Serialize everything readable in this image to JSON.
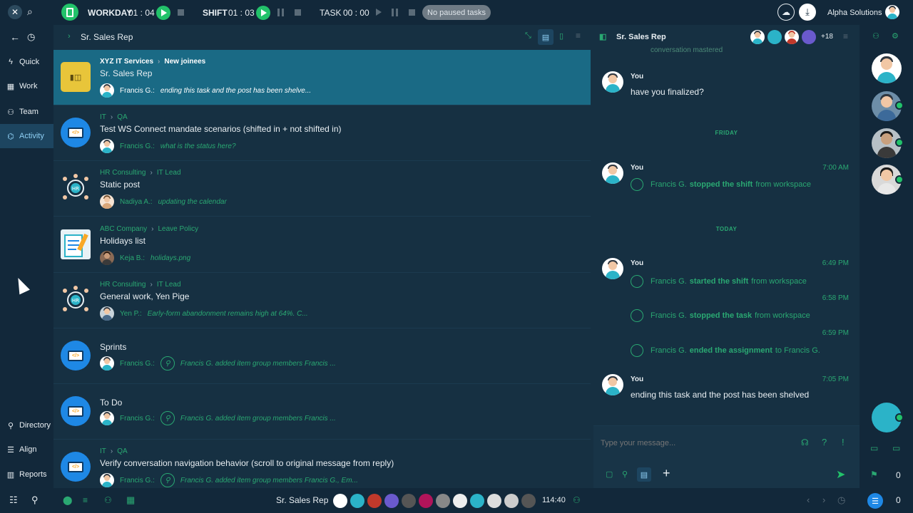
{
  "topbar": {
    "workday_label": "WORKDAY",
    "workday_time": "01 : 04",
    "shift_label": "SHIFT",
    "shift_time": "01 : 03",
    "task_label": "TASK",
    "task_time": "00 : 00",
    "paused_pill": "No paused tasks",
    "org_name": "Alpha Solutions"
  },
  "leftnav": {
    "items": [
      {
        "label": "Quick",
        "icon": "bolt-icon"
      },
      {
        "label": "Work",
        "icon": "grid-icon"
      },
      {
        "label": "Team",
        "icon": "team-icon"
      },
      {
        "label": "Activity",
        "icon": "activity-icon"
      }
    ],
    "bottom_items": [
      {
        "label": "Directory",
        "icon": "directory-icon"
      },
      {
        "label": "Align",
        "icon": "align-icon"
      },
      {
        "label": "Reports",
        "icon": "reports-icon"
      }
    ]
  },
  "list": {
    "header_title": "Sr. Sales Rep",
    "rows": [
      {
        "crumb_a": "XYZ IT Services",
        "crumb_b": "New joinees",
        "title": "Sr. Sales Rep",
        "name": "Francis G.:",
        "msg": "ending this task and the post has been shelve..."
      },
      {
        "crumb_a": "IT",
        "crumb_b": "QA",
        "title": "Test WS Connect mandate scenarios (shifted in + not shifted in)",
        "name": "Francis G.:",
        "msg": "what is the status here?"
      },
      {
        "crumb_a": "HR Consulting",
        "crumb_b": "IT Lead",
        "title": "Static post",
        "name": "Nadiya A.:",
        "msg": "updating the calendar"
      },
      {
        "crumb_a": "ABC Company",
        "crumb_b": "Leave Policy",
        "title": "Holidays list",
        "name": "Keja B.:",
        "msg": "holidays.png"
      },
      {
        "crumb_a": "HR Consulting",
        "crumb_b": "IT Lead",
        "title": "General work, Yen Pige",
        "name": "Yen P.:",
        "msg": "Early-form abandonment remains high at 64%. C..."
      },
      {
        "crumb_a": "",
        "crumb_b": "",
        "title": "Sprints",
        "name": "Francis G.:",
        "msg": "Francis G. added item group members Francis ..."
      },
      {
        "crumb_a": "",
        "crumb_b": "",
        "title": "To Do",
        "name": "Francis G.:",
        "msg": "Francis G. added item group members Francis ..."
      },
      {
        "crumb_a": "IT",
        "crumb_b": "QA",
        "title": "Verify conversation navigation behavior (scroll to original message from reply)",
        "name": "Francis G.:",
        "msg": "Francis G. added item group members Francis G., Em..."
      }
    ]
  },
  "chat": {
    "header_title": "Sr. Sales Rep",
    "member_count": "+18",
    "top_fragment": "conversation mastered",
    "msg1_author": "You",
    "msg1_text": "have you finalized?",
    "day_friday": "FRIDAY",
    "msg2_author": "You",
    "msg2_time": "7:00 AM",
    "msg2_sys_name": "Francis G.",
    "msg2_sys_action": "stopped the shift",
    "msg2_sys_tail": "from workspace",
    "day_today": "TODAY",
    "msg3_author": "You",
    "msg3_time": "6:49 PM",
    "sys3a_name": "Francis G.",
    "sys3a_action": "started the shift",
    "sys3a_tail": "from workspace",
    "sys3b_time": "6:58 PM",
    "sys3b_name": "Francis G.",
    "sys3b_action": "stopped the task",
    "sys3b_tail": "from workspace",
    "sys3c_time": "6:59 PM",
    "sys3c_name": "Francis G.",
    "sys3c_action": "ended the assignment",
    "sys3c_tail": "to Francis G.",
    "msg4_author": "You",
    "msg4_time": "7:05 PM",
    "msg4_text": "ending this task and the post has been shelved",
    "input_placeholder": "Type your message..."
  },
  "rightrail": {
    "flag_count": "0",
    "chat_count": "0"
  },
  "bottombar": {
    "context_title": "Sr. Sales Rep",
    "clock": "114:40"
  }
}
